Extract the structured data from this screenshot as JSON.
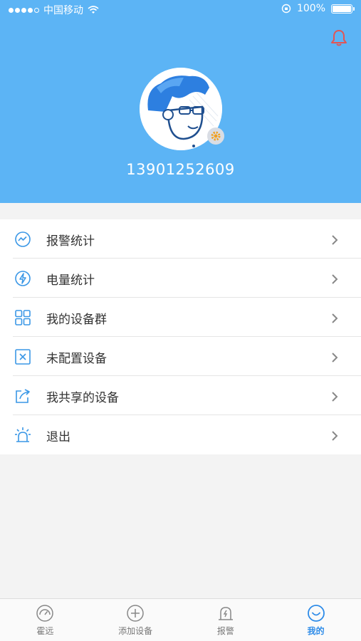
{
  "status_bar": {
    "carrier": "中国移动",
    "battery_text": "100%",
    "icons": [
      "signal-icon",
      "wifi-icon",
      "orientation-lock-icon",
      "battery-icon"
    ]
  },
  "profile": {
    "phone": "13901252609",
    "avatar_icon": "avatar-illustration",
    "settings_icon": "gear-icon",
    "notification_icon": "bell-icon"
  },
  "menu": {
    "items": [
      {
        "label": "报警统计",
        "icon": "trend-chart-icon"
      },
      {
        "label": "电量统计",
        "icon": "lightning-icon"
      },
      {
        "label": "我的设备群",
        "icon": "grid-icon"
      },
      {
        "label": "未配置设备",
        "icon": "x-box-icon"
      },
      {
        "label": "我共享的设备",
        "icon": "share-icon"
      },
      {
        "label": "退出",
        "icon": "alarm-light-icon"
      }
    ]
  },
  "tabbar": {
    "tabs": [
      {
        "label": "霍远",
        "icon": "dashboard-icon"
      },
      {
        "label": "添加设备",
        "icon": "plus-circle-icon"
      },
      {
        "label": "报警",
        "icon": "alarm-icon"
      },
      {
        "label": "我的",
        "icon": "smile-icon"
      }
    ],
    "active_index": 3
  },
  "colors": {
    "header_blue": "#5cb4f5",
    "icon_blue": "#3a97e6",
    "bell_red": "#e25555",
    "active_tab": "#2d8be8"
  }
}
